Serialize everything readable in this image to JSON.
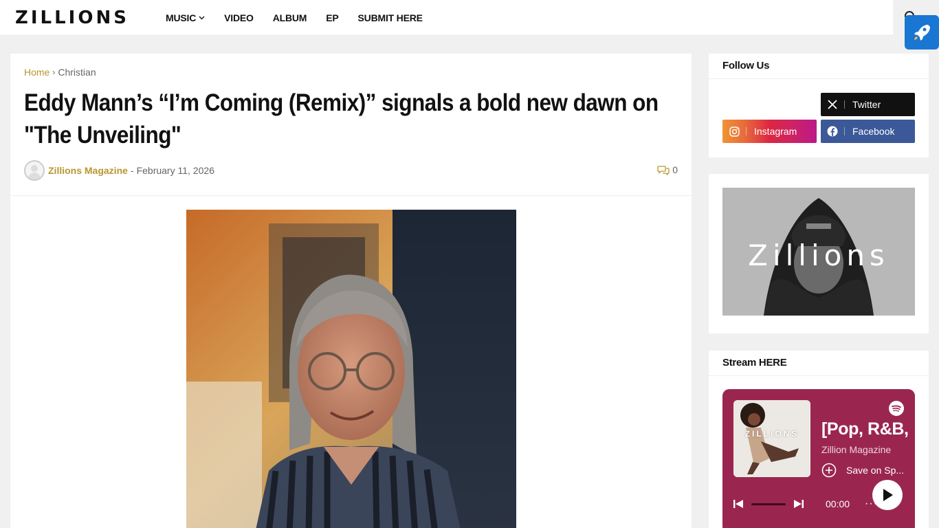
{
  "header": {
    "logo": "ZILLIONS",
    "nav": [
      "MUSIC",
      "VIDEO",
      "ALBUM",
      "EP",
      "SUBMIT HERE"
    ]
  },
  "breadcrumb": {
    "home": "Home",
    "separator": "›",
    "category": "Christian"
  },
  "article": {
    "title": "Eddy Mann’s “I’m Coming (Remix)” signals a bold new dawn on \"The Unveiling\"",
    "author": "Zillions Magazine",
    "meta_separator": "-",
    "date": "February 11, 2026",
    "comments": "0"
  },
  "sidebar": {
    "follow_heading": "Follow Us",
    "social": {
      "twitter": "Twitter",
      "instagram": "Instagram",
      "facebook": "Facebook"
    },
    "banner_text": "Zillions",
    "stream_heading": "Stream HERE",
    "player": {
      "cover_text": "ZILLIONS",
      "title": "[Pop, R&B,",
      "artist": "Zillion Magazine",
      "save_label": "Save on Sp...",
      "time": "00:00",
      "more": "···"
    }
  },
  "colors": {
    "accent": "#b8962e",
    "spotify_card": "#9a2650",
    "twitter": "#111111",
    "facebook": "#3b5998",
    "rocket": "#1976d2"
  }
}
